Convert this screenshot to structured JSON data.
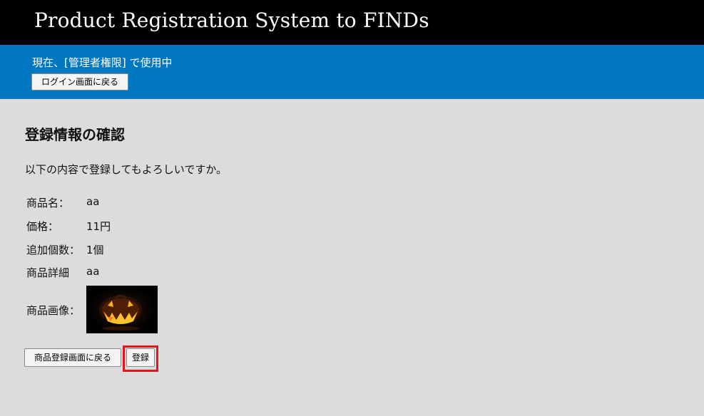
{
  "header": {
    "app_title": "Product Registration System to FINDs"
  },
  "user_bar": {
    "status_text": "現在、[管理者権限] で使用中",
    "back_to_login_label": "ログイン画面に戻る"
  },
  "main": {
    "title": "登録情報の確認",
    "intro": "以下の内容で登録してもよろしいですか。",
    "fields": {
      "name": {
        "label": "商品名：",
        "value": "aa"
      },
      "price": {
        "label": "価格：",
        "value": "11円"
      },
      "quantity": {
        "label": "追加個数：",
        "value": "1個"
      },
      "detail": {
        "label": "商品詳細",
        "value": "aa"
      },
      "image": {
        "label": "商品画像：",
        "icon": "jack-o-lantern-image"
      }
    },
    "buttons": {
      "back_label": "商品登録画面に戻る",
      "register_label": "登録"
    }
  },
  "colors": {
    "header_bg": "#000000",
    "user_bar_bg": "#0077c0",
    "page_bg": "#dcdcdc",
    "highlight": "#e0171d"
  }
}
